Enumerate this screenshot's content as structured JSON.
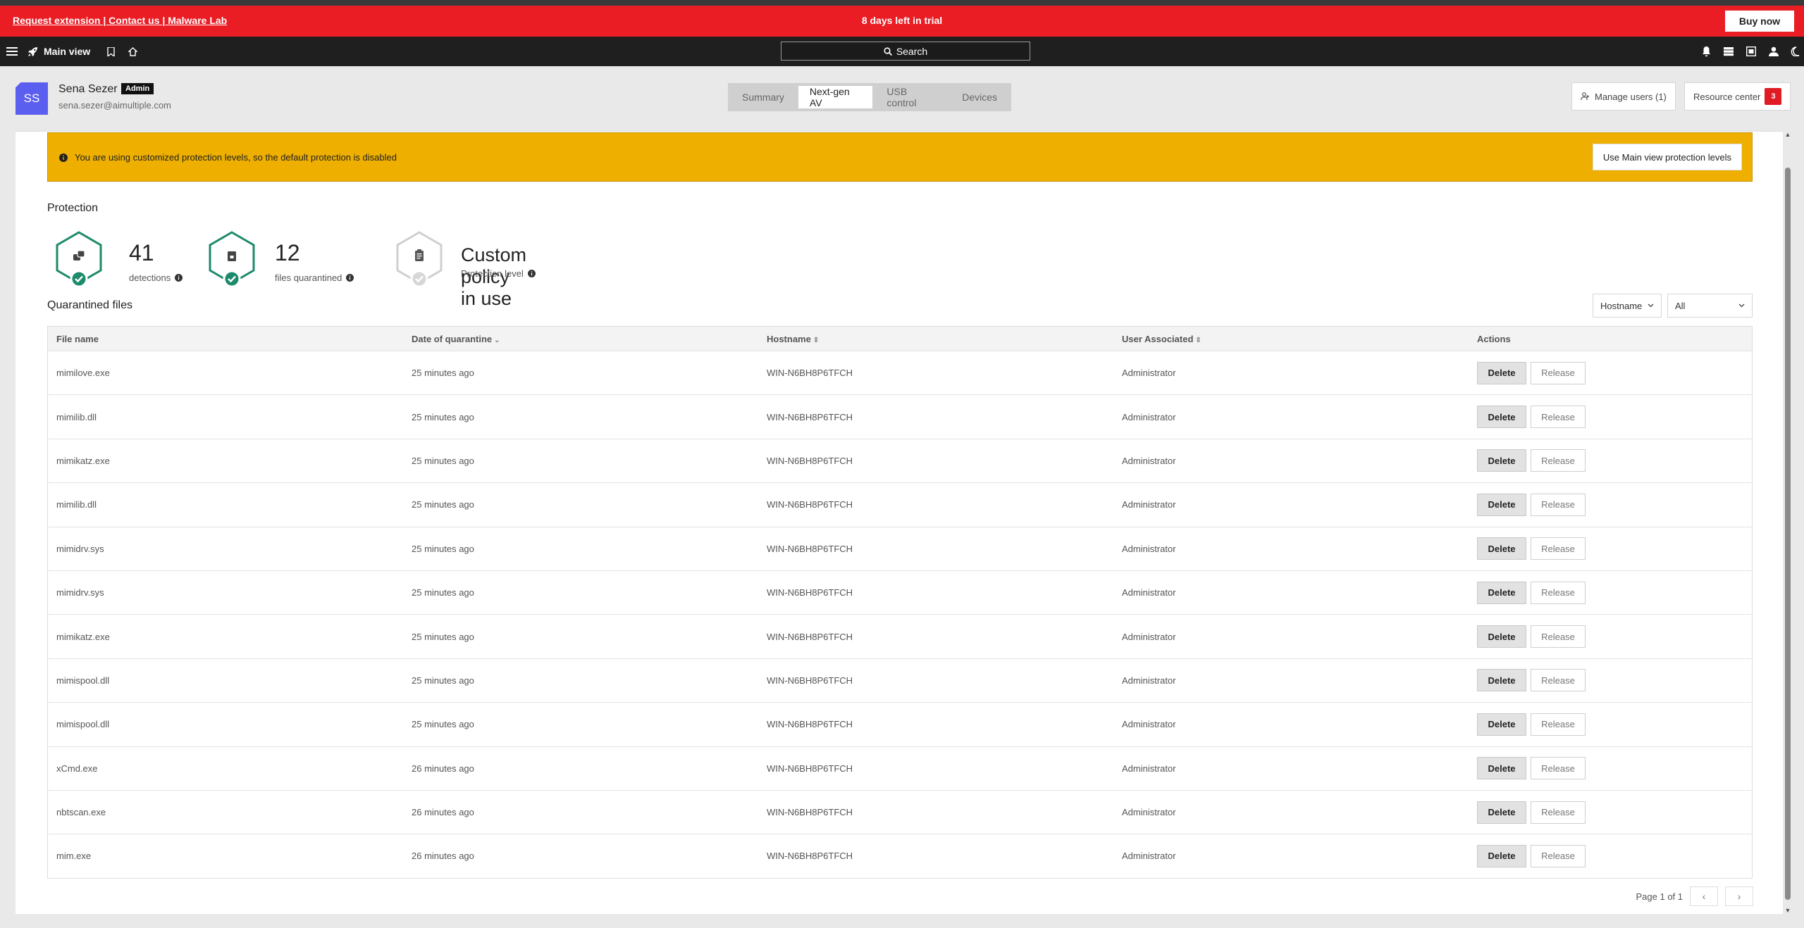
{
  "trial": {
    "links": "Request extension | Contact us | Malware Lab",
    "message": "8 days left in trial",
    "buy_label": "Buy now"
  },
  "nav": {
    "main_view": "Main view",
    "search_label": "Search"
  },
  "user": {
    "initials": "SS",
    "name": "Sena Sezer",
    "role": "Admin",
    "email": "sena.sezer@aimultiple.com"
  },
  "tabs": [
    "Summary",
    "Next-gen AV",
    "USB control",
    "Devices"
  ],
  "active_tab": "Next-gen AV",
  "header_buttons": {
    "manage_users": "Manage users (1)",
    "resource_center": "Resource center",
    "resource_count": "3"
  },
  "banner": {
    "text": "You are using customized protection levels, so the default protection is disabled",
    "button": "Use Main view protection levels",
    "color": "#eeaf00"
  },
  "protection": {
    "title": "Protection",
    "detections_value": "41",
    "detections_label": "detections",
    "quarantined_value": "12",
    "quarantined_label": "files quarantined",
    "policy_value": "Custom policy in use",
    "policy_label": "Protection level"
  },
  "quarantine": {
    "title": "Quarantined files",
    "filter_field": "Hostname",
    "filter_value": "All",
    "columns": [
      "File name",
      "Date of quarantine",
      "Hostname",
      "User Associated",
      "Actions"
    ],
    "delete_label": "Delete",
    "release_label": "Release",
    "rows": [
      {
        "file": "mimilove.exe",
        "date": "25 minutes ago",
        "host": "WIN-N6BH8P6TFCH",
        "user": "Administrator"
      },
      {
        "file": "mimilib.dll",
        "date": "25 minutes ago",
        "host": "WIN-N6BH8P6TFCH",
        "user": "Administrator"
      },
      {
        "file": "mimikatz.exe",
        "date": "25 minutes ago",
        "host": "WIN-N6BH8P6TFCH",
        "user": "Administrator"
      },
      {
        "file": "mimilib.dll",
        "date": "25 minutes ago",
        "host": "WIN-N6BH8P6TFCH",
        "user": "Administrator"
      },
      {
        "file": "mimidrv.sys",
        "date": "25 minutes ago",
        "host": "WIN-N6BH8P6TFCH",
        "user": "Administrator"
      },
      {
        "file": "mimidrv.sys",
        "date": "25 minutes ago",
        "host": "WIN-N6BH8P6TFCH",
        "user": "Administrator"
      },
      {
        "file": "mimikatz.exe",
        "date": "25 minutes ago",
        "host": "WIN-N6BH8P6TFCH",
        "user": "Administrator"
      },
      {
        "file": "mimispool.dll",
        "date": "25 minutes ago",
        "host": "WIN-N6BH8P6TFCH",
        "user": "Administrator"
      },
      {
        "file": "mimispool.dll",
        "date": "25 minutes ago",
        "host": "WIN-N6BH8P6TFCH",
        "user": "Administrator"
      },
      {
        "file": "xCmd.exe",
        "date": "26 minutes ago",
        "host": "WIN-N6BH8P6TFCH",
        "user": "Administrator"
      },
      {
        "file": "nbtscan.exe",
        "date": "26 minutes ago",
        "host": "WIN-N6BH8P6TFCH",
        "user": "Administrator"
      },
      {
        "file": "mim.exe",
        "date": "26 minutes ago",
        "host": "WIN-N6BH8P6TFCH",
        "user": "Administrator"
      }
    ]
  },
  "pagination": {
    "label": "Page 1 of 1"
  },
  "colors": {
    "trial_red": "#ea1c24",
    "accent_green": "#1d8a6b",
    "avatar_purple": "#5b5ff0"
  }
}
